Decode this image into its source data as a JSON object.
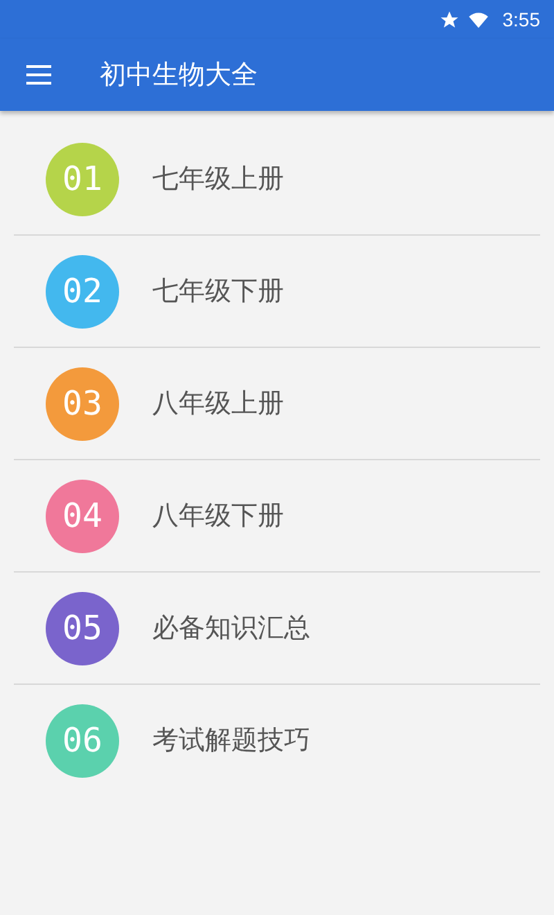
{
  "status_bar": {
    "time": "3:55"
  },
  "app_bar": {
    "title": "初中生物大全"
  },
  "items": [
    {
      "number": "01",
      "label": "七年级上册",
      "color": "#b5d44a"
    },
    {
      "number": "02",
      "label": "七年级下册",
      "color": "#43b8ee"
    },
    {
      "number": "03",
      "label": "八年级上册",
      "color": "#f39a3c"
    },
    {
      "number": "04",
      "label": "八年级下册",
      "color": "#f0789a"
    },
    {
      "number": "05",
      "label": "必备知识汇总",
      "color": "#7a64cc"
    },
    {
      "number": "06",
      "label": "考试解题技巧",
      "color": "#5bd1ad"
    }
  ]
}
